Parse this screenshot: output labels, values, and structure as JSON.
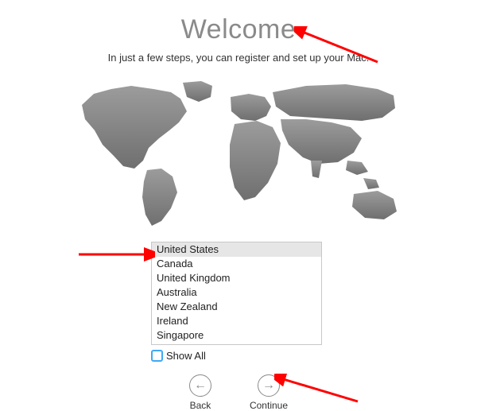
{
  "header": {
    "title": "Welcome",
    "subtitle": "In just a few steps, you can register and set up your Mac."
  },
  "countries": {
    "items": [
      "United States",
      "Canada",
      "United Kingdom",
      "Australia",
      "New Zealand",
      "Ireland",
      "Singapore"
    ],
    "selected_index": 0
  },
  "show_all": {
    "label": "Show All",
    "checked": false
  },
  "nav": {
    "back_label": "Back",
    "continue_label": "Continue"
  }
}
